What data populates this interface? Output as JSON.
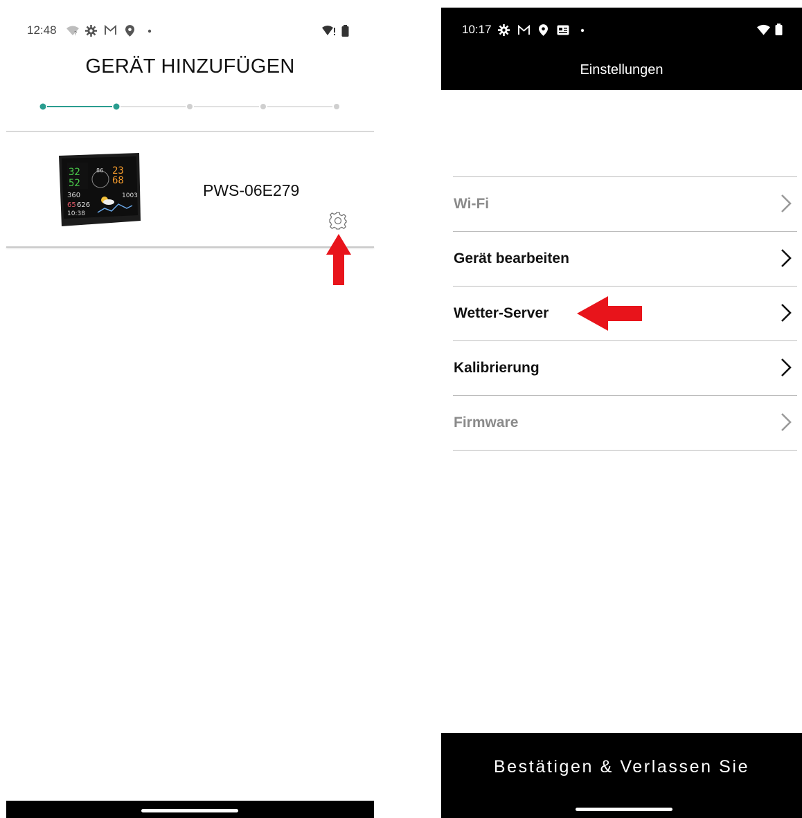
{
  "left": {
    "status_bar": {
      "time": "12:48"
    },
    "title": "GERÄT HINZUFÜGEN",
    "stepper": {
      "total_steps": 5,
      "completed_steps": 2
    },
    "device": {
      "name": "PWS-06E279"
    },
    "colors": {
      "accent": "#2a9d8f",
      "inactive": "#cfcfcf",
      "annotation_arrow": "#e8141b"
    }
  },
  "right": {
    "status_bar": {
      "time": "10:17"
    },
    "header_title": "Einstellungen",
    "menu": [
      {
        "label": "Wi-Fi",
        "enabled": false
      },
      {
        "label": "Gerät bearbeiten",
        "enabled": true
      },
      {
        "label": "Wetter-Server",
        "enabled": true
      },
      {
        "label": "Kalibrierung",
        "enabled": true
      },
      {
        "label": "Firmware",
        "enabled": false
      }
    ],
    "confirm_button": "Bestätigen & Verlassen Sie"
  }
}
